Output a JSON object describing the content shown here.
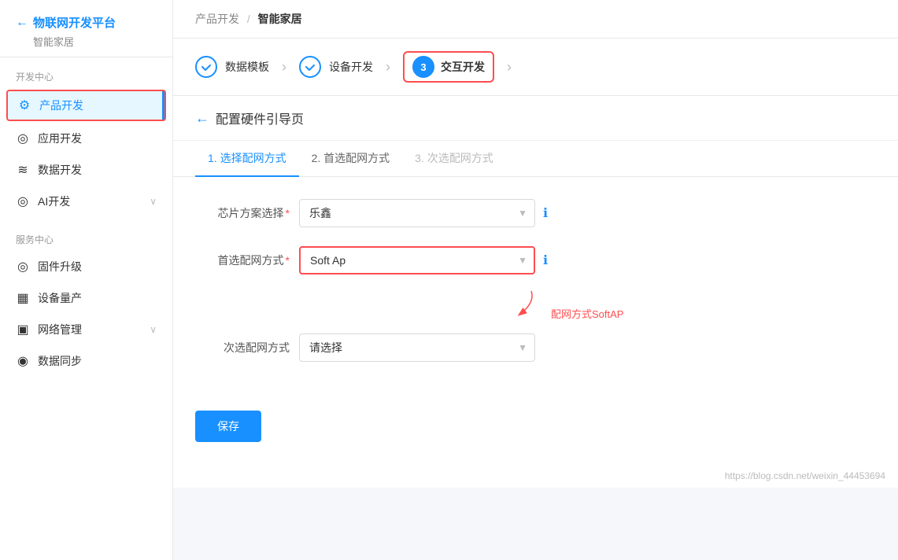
{
  "sidebar": {
    "back_label": "物联网开发平台",
    "subtitle": "智能家居",
    "section1": "开发中心",
    "items": [
      {
        "id": "product-dev",
        "label": "产品开发",
        "icon": "⚙",
        "active": true,
        "bordered": true
      },
      {
        "id": "app-dev",
        "label": "应用开发",
        "icon": "◎"
      },
      {
        "id": "data-dev",
        "label": "数据开发",
        "icon": "≋"
      },
      {
        "id": "ai-dev",
        "label": "AI开发",
        "icon": "◎",
        "hasChevron": true
      }
    ],
    "section2": "服务中心",
    "items2": [
      {
        "id": "firmware",
        "label": "固件升级",
        "icon": "◎"
      },
      {
        "id": "mass-prod",
        "label": "设备量产",
        "icon": "▦"
      },
      {
        "id": "network",
        "label": "网络管理",
        "icon": "▣",
        "hasChevron": true
      },
      {
        "id": "data-sync",
        "label": "数据同步",
        "icon": "◉"
      }
    ]
  },
  "breadcrumb": {
    "parent": "产品开发",
    "sep": "/",
    "current": "智能家居"
  },
  "steps": [
    {
      "id": "data-template",
      "label": "数据模板",
      "status": "done"
    },
    {
      "id": "device-dev",
      "label": "设备开发",
      "status": "done"
    },
    {
      "id": "interaction-dev",
      "label": "交互开发",
      "number": "3",
      "status": "active"
    }
  ],
  "back_nav_title": "配置硬件引导页",
  "tabs": [
    {
      "id": "network-mode",
      "label": "1. 选择配网方式",
      "active": true
    },
    {
      "id": "primary-mode",
      "label": "2. 首选配网方式",
      "active": false
    },
    {
      "id": "secondary-mode",
      "label": "3. 次选配网方式",
      "active": false,
      "disabled": true
    }
  ],
  "form": {
    "chip_label": "芯片方案选择",
    "chip_required": "*",
    "chip_value": "乐鑫",
    "primary_label": "首选配网方式",
    "primary_required": "*",
    "primary_value": "Soft Ap",
    "secondary_label": "次选配网方式",
    "secondary_placeholder": "请选择"
  },
  "annotation": {
    "text": "配网方式SoftAP"
  },
  "save_button": "保存",
  "watermark": "https://blog.csdn.net/weixin_44453694"
}
